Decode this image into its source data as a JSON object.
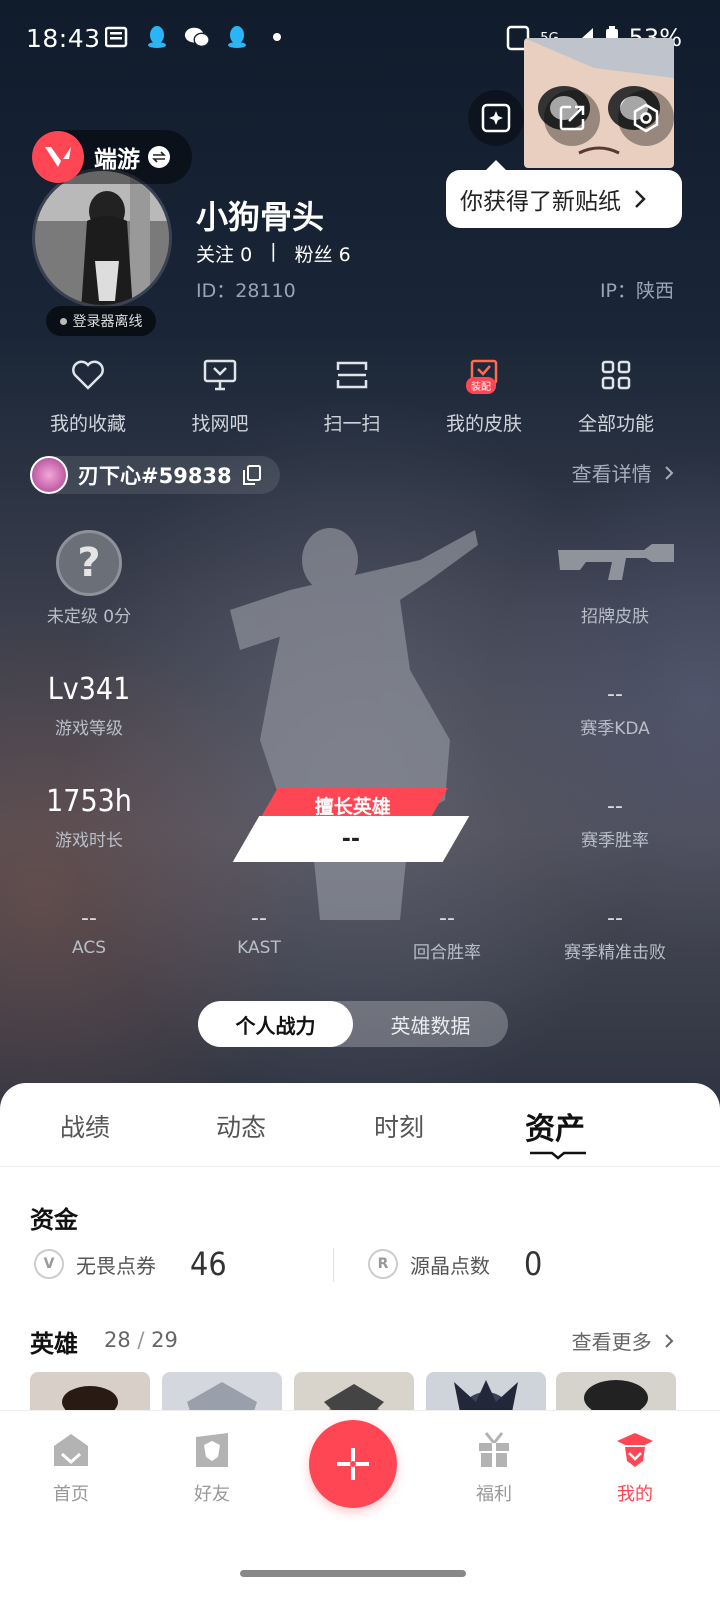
{
  "status_bar": {
    "time": "18:43",
    "network": "5G",
    "battery": "53%"
  },
  "header": {
    "game_label": "端游",
    "tooltip": "你获得了新贴纸",
    "offline_label": "登录器离线"
  },
  "profile": {
    "username": "小狗骨头",
    "follow_label": "关注",
    "follow_count": "0",
    "fans_label": "粉丝",
    "fans_count": "6",
    "separator": "|",
    "id": "ID：28110",
    "ip": "IP：陕西"
  },
  "quick_actions": [
    {
      "label": "我的收藏",
      "icon": "heart-icon"
    },
    {
      "label": "找网吧",
      "icon": "monitor-icon"
    },
    {
      "label": "扫一扫",
      "icon": "scan-icon"
    },
    {
      "label": "我的皮肤",
      "icon": "skin-icon",
      "badge": "装配"
    },
    {
      "label": "全部功能",
      "icon": "grid-icon"
    }
  ],
  "riot_id": "刃下心#59838",
  "view_details": "查看详情",
  "stats": {
    "rank": {
      "label": "未定级 0分",
      "badge": "?"
    },
    "signature_skin": "招牌皮肤",
    "level": {
      "value": "Lv341",
      "label": "游戏等级"
    },
    "playtime": {
      "value": "1753h",
      "label": "游戏时长"
    },
    "kda": {
      "value": "--",
      "label": "赛季KDA"
    },
    "winrate": {
      "value": "--",
      "label": "赛季胜率"
    },
    "acs": {
      "value": "--",
      "label": "ACS"
    },
    "kast": {
      "value": "--",
      "label": "KAST"
    },
    "round_winrate": {
      "value": "--",
      "label": "回合胜率"
    },
    "precision_kills": {
      "value": "--",
      "label": "赛季精准击败"
    },
    "best_hero_tag": "擅长英雄",
    "best_hero_value": "--"
  },
  "toggle": {
    "options": [
      "个人战力",
      "英雄数据"
    ],
    "active": 0
  },
  "tabs": [
    "战绩",
    "动态",
    "时刻",
    "资产"
  ],
  "active_tab": 3,
  "funds": {
    "title": "资金",
    "items": [
      {
        "label": "无畏点券",
        "value": "46",
        "icon": "V"
      },
      {
        "label": "源晶点数",
        "value": "0",
        "icon": "R"
      }
    ]
  },
  "heroes": {
    "title": "英雄",
    "owned": "28",
    "total": "29",
    "more": "查看更多"
  },
  "nav": [
    {
      "label": "首页",
      "icon": "home-icon"
    },
    {
      "label": "好友",
      "icon": "friends-icon"
    },
    {
      "label": "",
      "icon": "plus-icon"
    },
    {
      "label": "福利",
      "icon": "gift-icon"
    },
    {
      "label": "我的",
      "icon": "profile-icon"
    }
  ],
  "colors": {
    "accent": "#ff4655",
    "panel": "#ffffff",
    "header_bg": "#1a2637"
  }
}
